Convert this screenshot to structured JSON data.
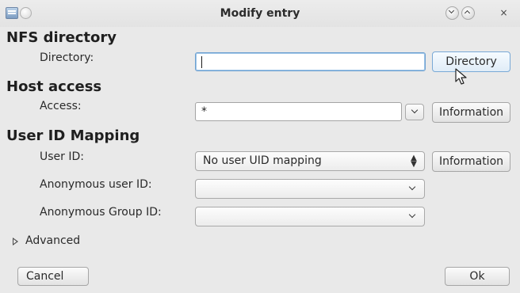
{
  "window": {
    "title": "Modify entry",
    "icons": {
      "app": "app-icon",
      "pin": "pin-icon",
      "minimize": "chevron-down-icon",
      "maximize": "chevron-up-icon",
      "close": "close-icon"
    },
    "close_glyph": "×"
  },
  "nfs_directory": {
    "heading": "NFS directory",
    "directory_label": "Directory:",
    "directory_value": "",
    "directory_button": "Directory"
  },
  "host_access": {
    "heading": "Host access",
    "access_label": "Access:",
    "access_value": "*",
    "information_button": "Information"
  },
  "user_id_mapping": {
    "heading": "User ID Mapping",
    "user_id_label": "User ID:",
    "user_id_selected": "No user UID mapping",
    "information_button": "Information",
    "anon_user_label": "Anonymous user ID:",
    "anon_user_value": "",
    "anon_group_label": "Anonymous Group ID:",
    "anon_group_value": ""
  },
  "advanced": {
    "label": "Advanced"
  },
  "footer": {
    "cancel": "Cancel",
    "ok": "Ok"
  },
  "colors": {
    "focus_border": "#6ea1d1",
    "window_bg": "#e9e9e9",
    "hover_border": "#79a9d6"
  }
}
